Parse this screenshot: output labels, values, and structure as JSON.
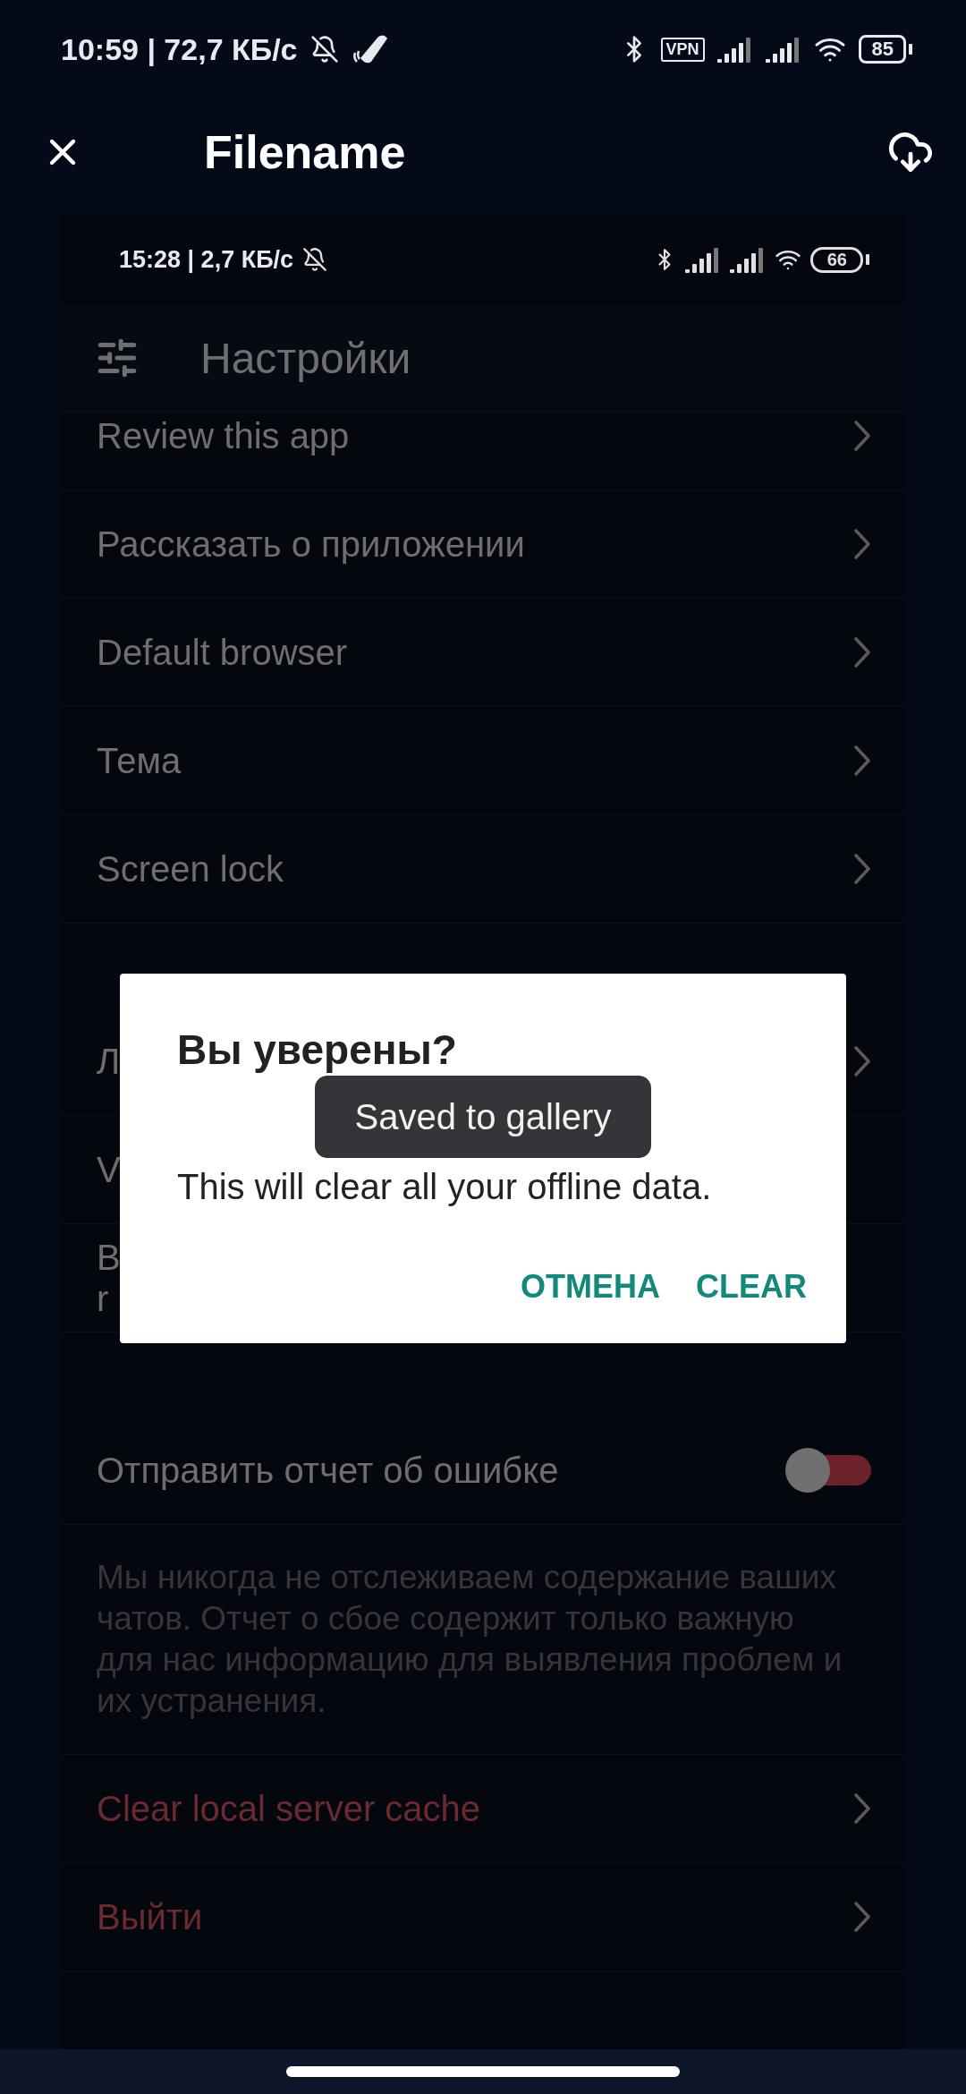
{
  "status_bar": {
    "time": "10:59 | 72,7 КБ/с",
    "vpn": "VPN",
    "battery": "85"
  },
  "top_bar": {
    "title": "Filename"
  },
  "screenshot": {
    "status_bar": {
      "time": "15:28 | 2,7 КБ/с",
      "battery": "66"
    },
    "header": {
      "title": "Настройки"
    },
    "groups": [
      {
        "items": [
          {
            "kind": "link",
            "label": "Review this app",
            "danger": false
          },
          {
            "kind": "link",
            "label": "Рассказать о приложении",
            "danger": false
          },
          {
            "kind": "link",
            "label": "Default browser",
            "danger": false
          },
          {
            "kind": "link",
            "label": "Тема",
            "danger": false
          },
          {
            "kind": "link",
            "label": "Screen lock",
            "danger": false
          }
        ]
      },
      {
        "items": [
          {
            "kind": "link",
            "label": "Л",
            "danger": false
          },
          {
            "kind": "plain",
            "lines": [
              "V"
            ]
          },
          {
            "kind": "plain",
            "lines": [
              "В",
              "r"
            ]
          }
        ]
      },
      {
        "items": [
          {
            "kind": "switch",
            "label": "Отправить отчет об ошибке",
            "on": false
          },
          {
            "kind": "note",
            "text": "Мы никогда не отслеживаем содержание ваших чатов. Отчет о сбое содержит только важную для нас информацию для выявления проблем и их устранения."
          },
          {
            "kind": "link",
            "label": "Clear local server cache",
            "danger": true
          },
          {
            "kind": "link",
            "label": "Выйти",
            "danger": true
          }
        ]
      }
    ],
    "dialog": {
      "title": "Вы уверены?",
      "message": "This will clear all your offline data.",
      "buttons": [
        "ОТМЕНА",
        "CLEAR"
      ]
    },
    "toast": {
      "text": "Saved to gallery"
    }
  }
}
